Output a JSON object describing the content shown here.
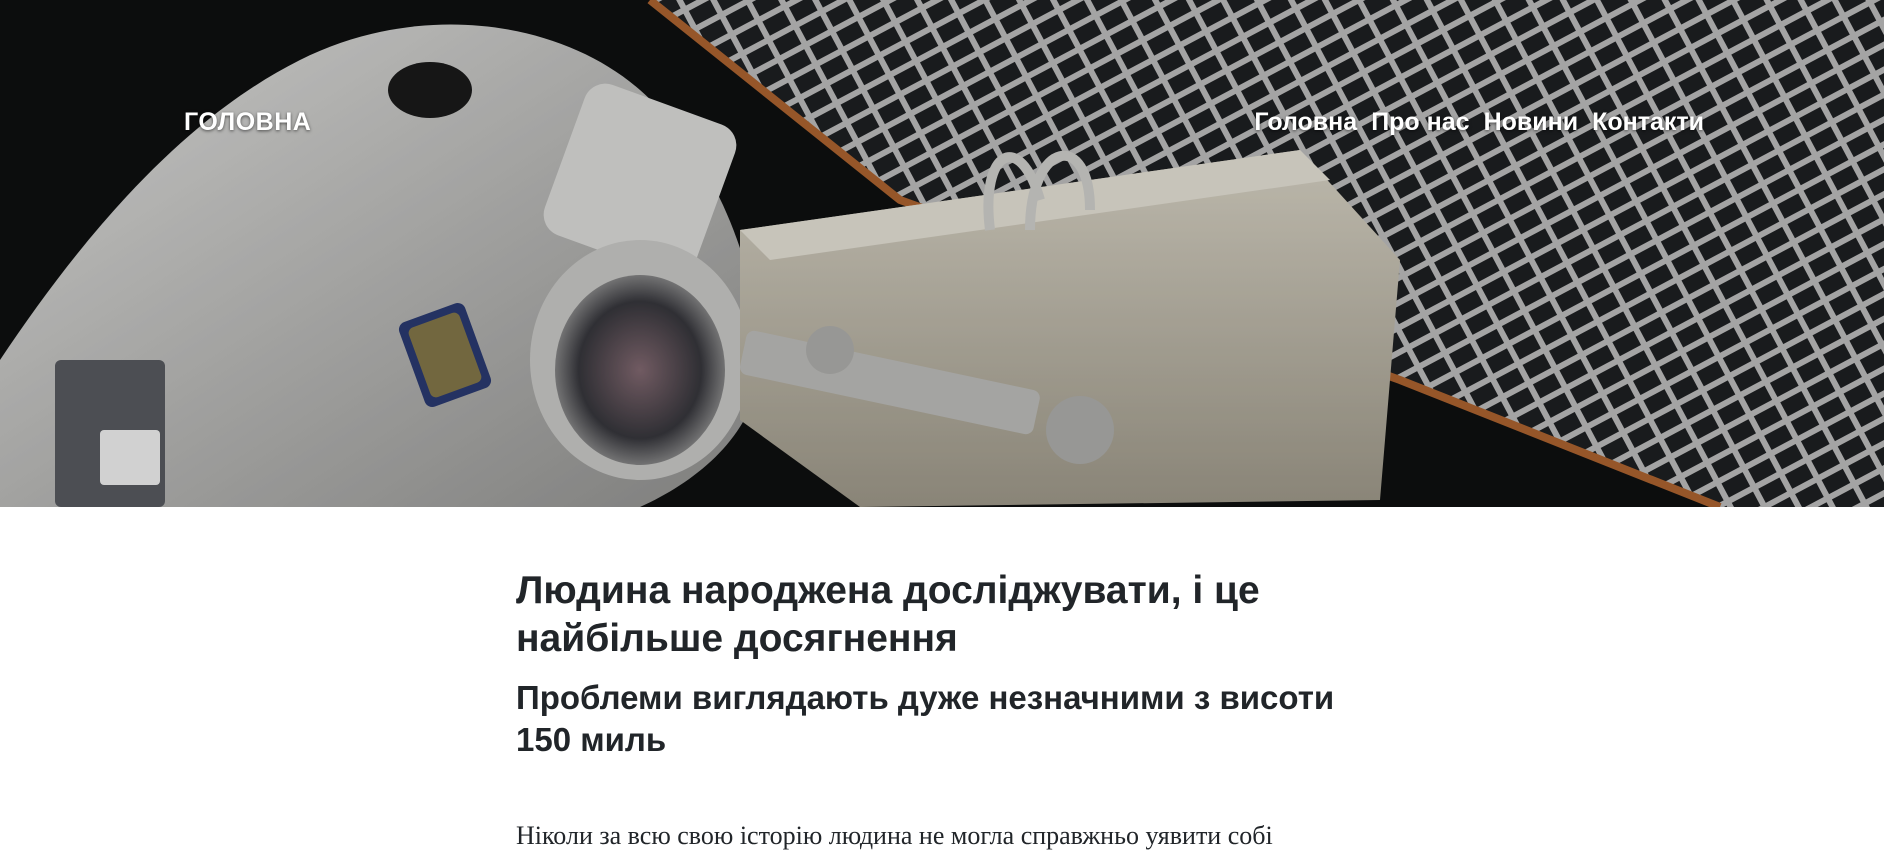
{
  "header": {
    "brand": "ГОЛОВНА",
    "nav": [
      {
        "label": "Головна"
      },
      {
        "label": "Про нас"
      },
      {
        "label": "Новини"
      },
      {
        "label": "Контакти"
      }
    ],
    "hero_image": "astronaut-spacewalk-photo"
  },
  "article": {
    "title": "Людина народжена досліджувати, і це найбільше досягнення",
    "subtitle": "Проблеми виглядають дуже незначними з висоти 150 миль",
    "paragraph": "Ніколи за всю свою історію людина не могла справжньо уявити собі"
  },
  "colors": {
    "text": "#212529",
    "nav_text": "#ffffff",
    "background": "#ffffff",
    "space": "#0f1011"
  }
}
